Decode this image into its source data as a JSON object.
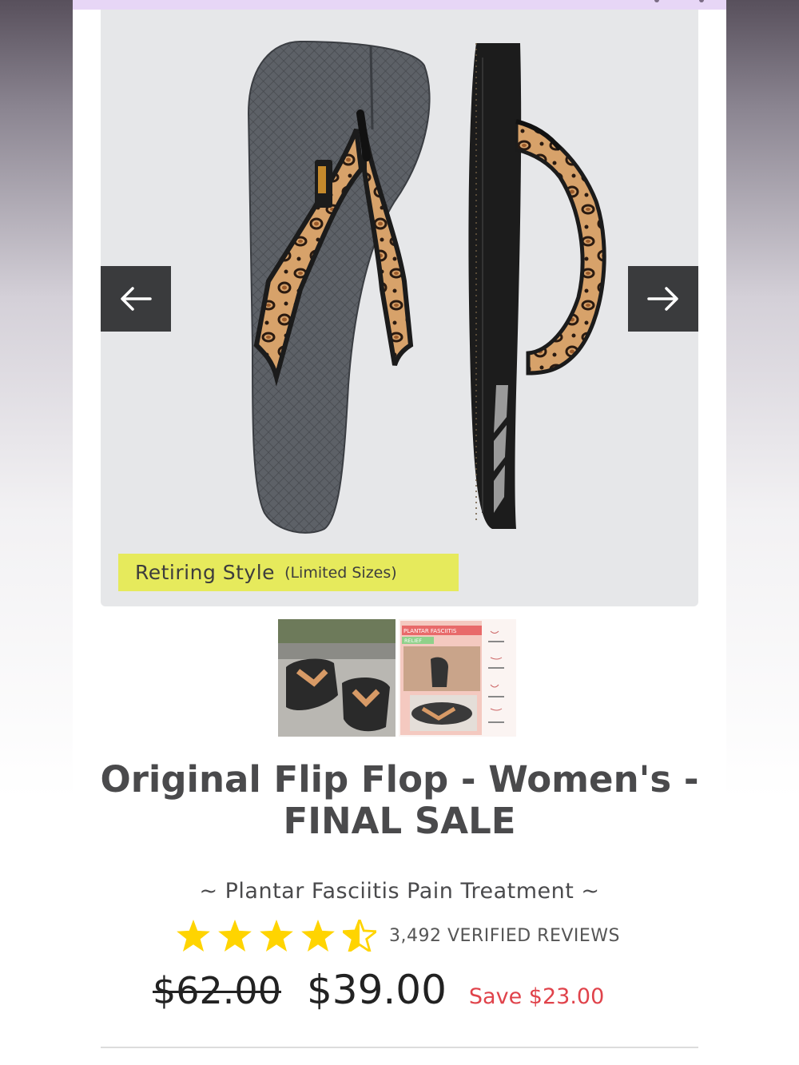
{
  "product": {
    "badge_main": "Retiring Style",
    "badge_sub": "(Limited Sizes)",
    "title_line1": "Original Flip Flop - Women's -",
    "title_line2": "FINAL SALE",
    "subtitle": "~ Plantar Fasciitis Pain Treatment ~",
    "rating_value": 4.5,
    "reviews_label": "3,492 VERIFIED REVIEWS",
    "price_original": "$62.00",
    "price_sale": "$39.00",
    "price_save": "Save $23.00"
  },
  "gallery": {
    "thumb2_banner_line1": "PLANTAR FASCIITIS",
    "thumb2_banner_line2": "RELIEF"
  },
  "colors": {
    "badge_bg": "#e6ea5c",
    "star": "#ffd400",
    "save_text": "#e0434b",
    "arrow_bg": "#3a3b3d",
    "top_strip": "#e7d6f6"
  },
  "icons": [
    "arrow-left-icon",
    "arrow-right-icon",
    "star-icon",
    "half-star-icon"
  ]
}
